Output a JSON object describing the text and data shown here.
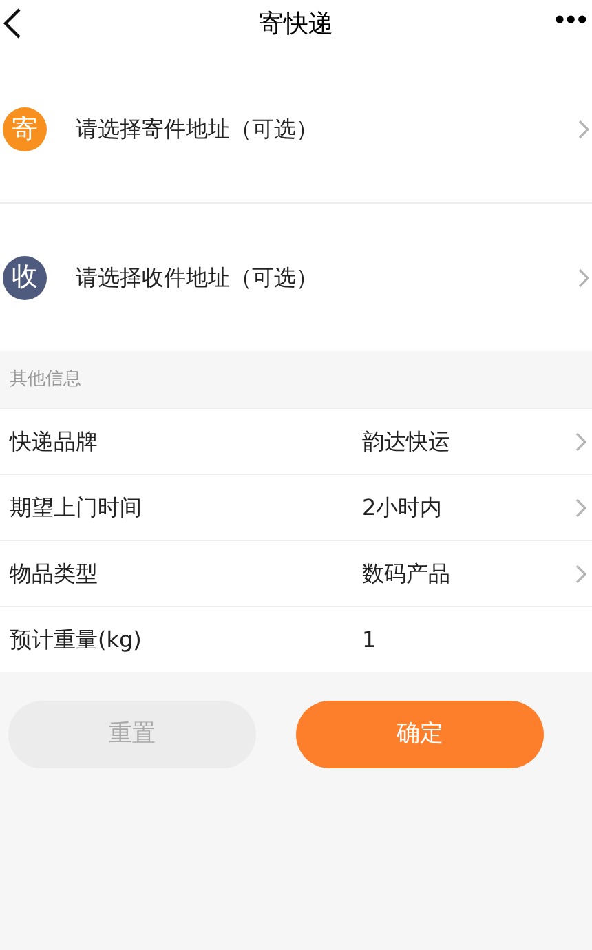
{
  "header": {
    "title": "寄快递",
    "more": "•••"
  },
  "addresses": [
    {
      "badge": "寄",
      "label": "请选择寄件地址（可选）",
      "color": "#f7901e"
    },
    {
      "badge": "收",
      "label": "请选择收件地址（可选）",
      "color": "#4e5a7e"
    }
  ],
  "section_title": "其他信息",
  "fields": [
    {
      "label": "快递品牌",
      "value": "韵达快运",
      "has_arrow": true
    },
    {
      "label": "期望上门时间",
      "value": "2小时内",
      "has_arrow": true
    },
    {
      "label": "物品类型",
      "value": "数码产品",
      "has_arrow": true
    },
    {
      "label": "预计重量(kg)",
      "value": "1",
      "has_arrow": false
    }
  ],
  "buttons": [
    {
      "label": "重置",
      "kind": "secondary"
    },
    {
      "label": "确定",
      "kind": "primary"
    }
  ]
}
